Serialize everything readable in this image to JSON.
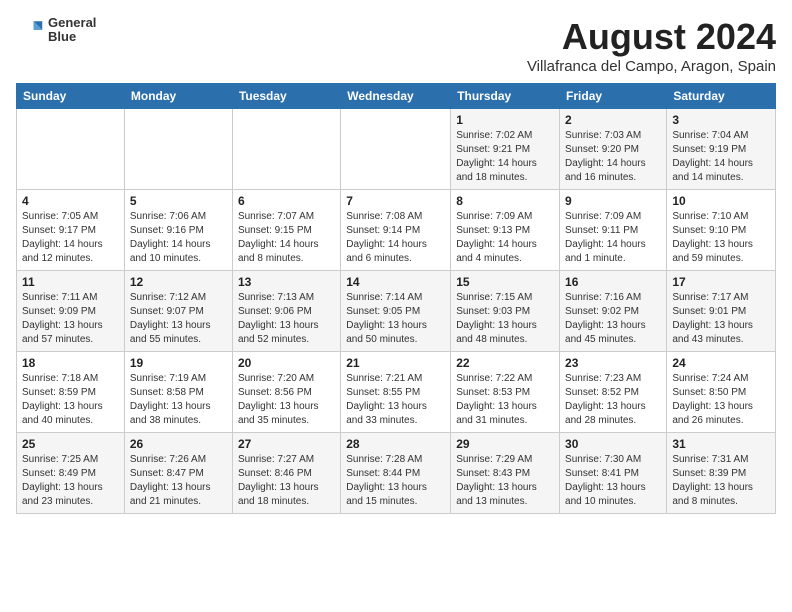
{
  "header": {
    "logo_line1": "General",
    "logo_line2": "Blue",
    "month_year": "August 2024",
    "location": "Villafranca del Campo, Aragon, Spain"
  },
  "weekdays": [
    "Sunday",
    "Monday",
    "Tuesday",
    "Wednesday",
    "Thursday",
    "Friday",
    "Saturday"
  ],
  "weeks": [
    [
      {
        "day": "",
        "info": ""
      },
      {
        "day": "",
        "info": ""
      },
      {
        "day": "",
        "info": ""
      },
      {
        "day": "",
        "info": ""
      },
      {
        "day": "1",
        "info": "Sunrise: 7:02 AM\nSunset: 9:21 PM\nDaylight: 14 hours\nand 18 minutes."
      },
      {
        "day": "2",
        "info": "Sunrise: 7:03 AM\nSunset: 9:20 PM\nDaylight: 14 hours\nand 16 minutes."
      },
      {
        "day": "3",
        "info": "Sunrise: 7:04 AM\nSunset: 9:19 PM\nDaylight: 14 hours\nand 14 minutes."
      }
    ],
    [
      {
        "day": "4",
        "info": "Sunrise: 7:05 AM\nSunset: 9:17 PM\nDaylight: 14 hours\nand 12 minutes."
      },
      {
        "day": "5",
        "info": "Sunrise: 7:06 AM\nSunset: 9:16 PM\nDaylight: 14 hours\nand 10 minutes."
      },
      {
        "day": "6",
        "info": "Sunrise: 7:07 AM\nSunset: 9:15 PM\nDaylight: 14 hours\nand 8 minutes."
      },
      {
        "day": "7",
        "info": "Sunrise: 7:08 AM\nSunset: 9:14 PM\nDaylight: 14 hours\nand 6 minutes."
      },
      {
        "day": "8",
        "info": "Sunrise: 7:09 AM\nSunset: 9:13 PM\nDaylight: 14 hours\nand 4 minutes."
      },
      {
        "day": "9",
        "info": "Sunrise: 7:09 AM\nSunset: 9:11 PM\nDaylight: 14 hours\nand 1 minute."
      },
      {
        "day": "10",
        "info": "Sunrise: 7:10 AM\nSunset: 9:10 PM\nDaylight: 13 hours\nand 59 minutes."
      }
    ],
    [
      {
        "day": "11",
        "info": "Sunrise: 7:11 AM\nSunset: 9:09 PM\nDaylight: 13 hours\nand 57 minutes."
      },
      {
        "day": "12",
        "info": "Sunrise: 7:12 AM\nSunset: 9:07 PM\nDaylight: 13 hours\nand 55 minutes."
      },
      {
        "day": "13",
        "info": "Sunrise: 7:13 AM\nSunset: 9:06 PM\nDaylight: 13 hours\nand 52 minutes."
      },
      {
        "day": "14",
        "info": "Sunrise: 7:14 AM\nSunset: 9:05 PM\nDaylight: 13 hours\nand 50 minutes."
      },
      {
        "day": "15",
        "info": "Sunrise: 7:15 AM\nSunset: 9:03 PM\nDaylight: 13 hours\nand 48 minutes."
      },
      {
        "day": "16",
        "info": "Sunrise: 7:16 AM\nSunset: 9:02 PM\nDaylight: 13 hours\nand 45 minutes."
      },
      {
        "day": "17",
        "info": "Sunrise: 7:17 AM\nSunset: 9:01 PM\nDaylight: 13 hours\nand 43 minutes."
      }
    ],
    [
      {
        "day": "18",
        "info": "Sunrise: 7:18 AM\nSunset: 8:59 PM\nDaylight: 13 hours\nand 40 minutes."
      },
      {
        "day": "19",
        "info": "Sunrise: 7:19 AM\nSunset: 8:58 PM\nDaylight: 13 hours\nand 38 minutes."
      },
      {
        "day": "20",
        "info": "Sunrise: 7:20 AM\nSunset: 8:56 PM\nDaylight: 13 hours\nand 35 minutes."
      },
      {
        "day": "21",
        "info": "Sunrise: 7:21 AM\nSunset: 8:55 PM\nDaylight: 13 hours\nand 33 minutes."
      },
      {
        "day": "22",
        "info": "Sunrise: 7:22 AM\nSunset: 8:53 PM\nDaylight: 13 hours\nand 31 minutes."
      },
      {
        "day": "23",
        "info": "Sunrise: 7:23 AM\nSunset: 8:52 PM\nDaylight: 13 hours\nand 28 minutes."
      },
      {
        "day": "24",
        "info": "Sunrise: 7:24 AM\nSunset: 8:50 PM\nDaylight: 13 hours\nand 26 minutes."
      }
    ],
    [
      {
        "day": "25",
        "info": "Sunrise: 7:25 AM\nSunset: 8:49 PM\nDaylight: 13 hours\nand 23 minutes."
      },
      {
        "day": "26",
        "info": "Sunrise: 7:26 AM\nSunset: 8:47 PM\nDaylight: 13 hours\nand 21 minutes."
      },
      {
        "day": "27",
        "info": "Sunrise: 7:27 AM\nSunset: 8:46 PM\nDaylight: 13 hours\nand 18 minutes."
      },
      {
        "day": "28",
        "info": "Sunrise: 7:28 AM\nSunset: 8:44 PM\nDaylight: 13 hours\nand 15 minutes."
      },
      {
        "day": "29",
        "info": "Sunrise: 7:29 AM\nSunset: 8:43 PM\nDaylight: 13 hours\nand 13 minutes."
      },
      {
        "day": "30",
        "info": "Sunrise: 7:30 AM\nSunset: 8:41 PM\nDaylight: 13 hours\nand 10 minutes."
      },
      {
        "day": "31",
        "info": "Sunrise: 7:31 AM\nSunset: 8:39 PM\nDaylight: 13 hours\nand 8 minutes."
      }
    ]
  ]
}
